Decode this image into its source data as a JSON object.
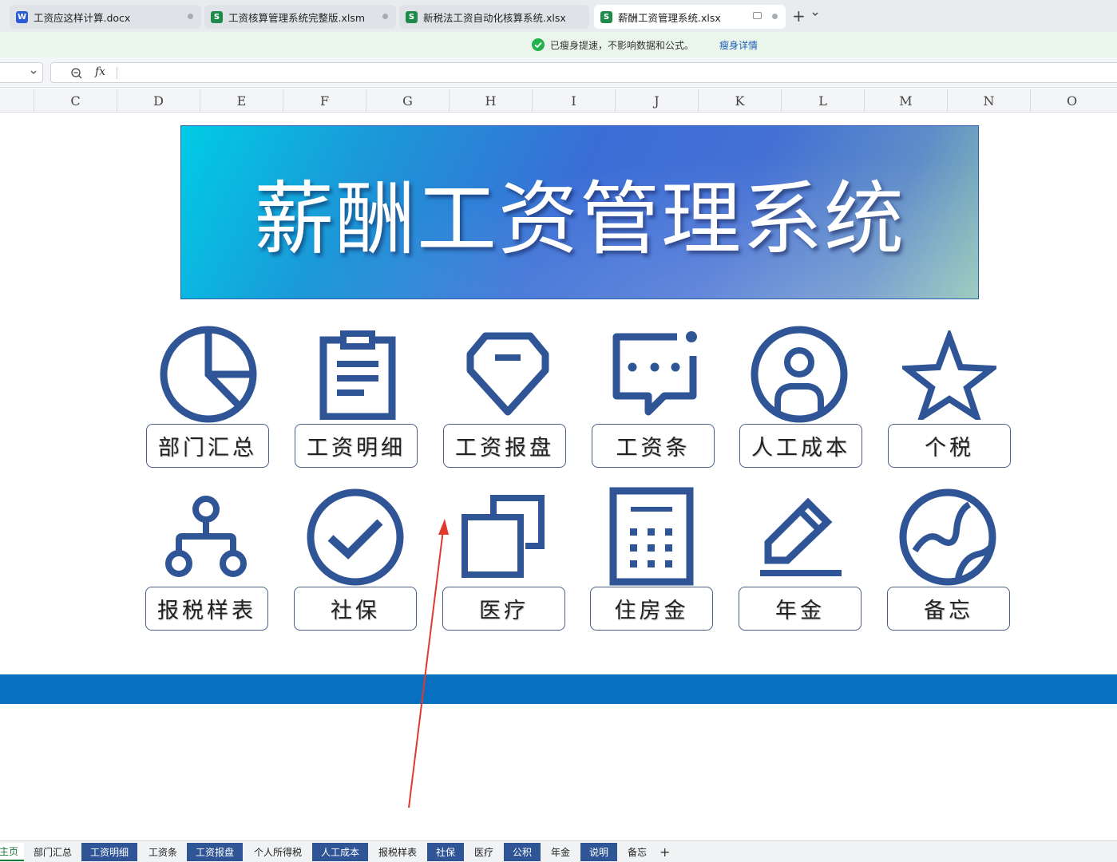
{
  "tabs": [
    {
      "label": "工资应这样计算.docx",
      "type": "W",
      "color": "#2b5cd6"
    },
    {
      "label": "工资核算管理系统完整版.xlsm",
      "type": "S",
      "color": "#1f8a4c"
    },
    {
      "label": "新税法工资自动化核算系统.xlsx",
      "type": "S",
      "color": "#1f8a4c"
    },
    {
      "label": "薪酬工资管理系统.xlsx",
      "type": "S",
      "color": "#1f8a4c"
    }
  ],
  "new_tab_label": "+",
  "notice": {
    "message": "已瘦身提速，不影响数据和公式。",
    "link": "瘦身详情"
  },
  "formula": {
    "fx": "fx"
  },
  "columns": [
    "C",
    "D",
    "E",
    "F",
    "G",
    "H",
    "I",
    "J",
    "K",
    "L",
    "M",
    "N",
    "O"
  ],
  "banner": {
    "title": "薪酬工资管理系统"
  },
  "tiles": [
    {
      "label": "部门汇总",
      "icon": "pie-chart-icon"
    },
    {
      "label": "工资明细",
      "icon": "clipboard-icon"
    },
    {
      "label": "工资报盘",
      "icon": "shield-icon"
    },
    {
      "label": "工资条",
      "icon": "chat-bubble-icon"
    },
    {
      "label": "人工成本",
      "icon": "user-icon"
    },
    {
      "label": "个税",
      "icon": "star-icon"
    },
    {
      "label": "报税样表",
      "icon": "org-chart-icon"
    },
    {
      "label": "社保",
      "icon": "check-circle-icon"
    },
    {
      "label": "医疗",
      "icon": "copy-icon"
    },
    {
      "label": "住房金",
      "icon": "calculator-icon"
    },
    {
      "label": "年金",
      "icon": "pencil-icon"
    },
    {
      "label": "备忘",
      "icon": "globe-icon"
    }
  ],
  "sheets": [
    {
      "label": "主页",
      "state": "current"
    },
    {
      "label": "部门汇总",
      "state": "normal"
    },
    {
      "label": "工资明细",
      "state": "highlight"
    },
    {
      "label": "工资条",
      "state": "normal"
    },
    {
      "label": "工资报盘",
      "state": "highlight"
    },
    {
      "label": "个人所得税",
      "state": "normal"
    },
    {
      "label": "人工成本",
      "state": "highlight"
    },
    {
      "label": "报税样表",
      "state": "normal"
    },
    {
      "label": "社保",
      "state": "highlight"
    },
    {
      "label": "医疗",
      "state": "normal"
    },
    {
      "label": "公积",
      "state": "highlight"
    },
    {
      "label": "年金",
      "state": "normal"
    },
    {
      "label": "说明",
      "state": "highlight"
    },
    {
      "label": "备忘",
      "state": "normal"
    }
  ],
  "add_sheet_label": "+",
  "colors": {
    "icon": "#2f5597",
    "strip": "#0870c0",
    "arrow": "#e03a2e"
  }
}
